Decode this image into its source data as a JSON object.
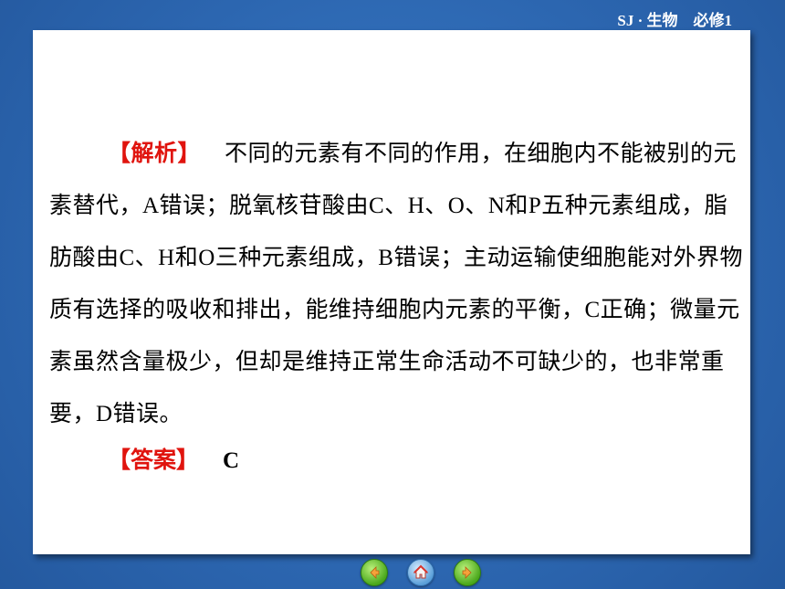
{
  "header": {
    "course_label": "SJ · 生物　必修1"
  },
  "analysis": {
    "tag": "【解析】",
    "text": "不同的元素有不同的作用，在细胞内不能被别的元素替代，A错误；脱氧核苷酸由C、H、O、N和P五种元素组成，脂肪酸由C、H和O三种元素组成，B错误；主动运输使细胞能对外界物质有选择的吸收和排出，能维持细胞内元素的平衡，C正确；微量元素虽然含量极少，但却是维持正常生命活动不可缺少的，也非常重要，D错误。"
  },
  "answer": {
    "tag": "【答案】",
    "value": "C"
  },
  "nav": {
    "prev_icon": "left-arrow-icon",
    "home_icon": "home-icon",
    "next_icon": "right-arrow-icon"
  }
}
